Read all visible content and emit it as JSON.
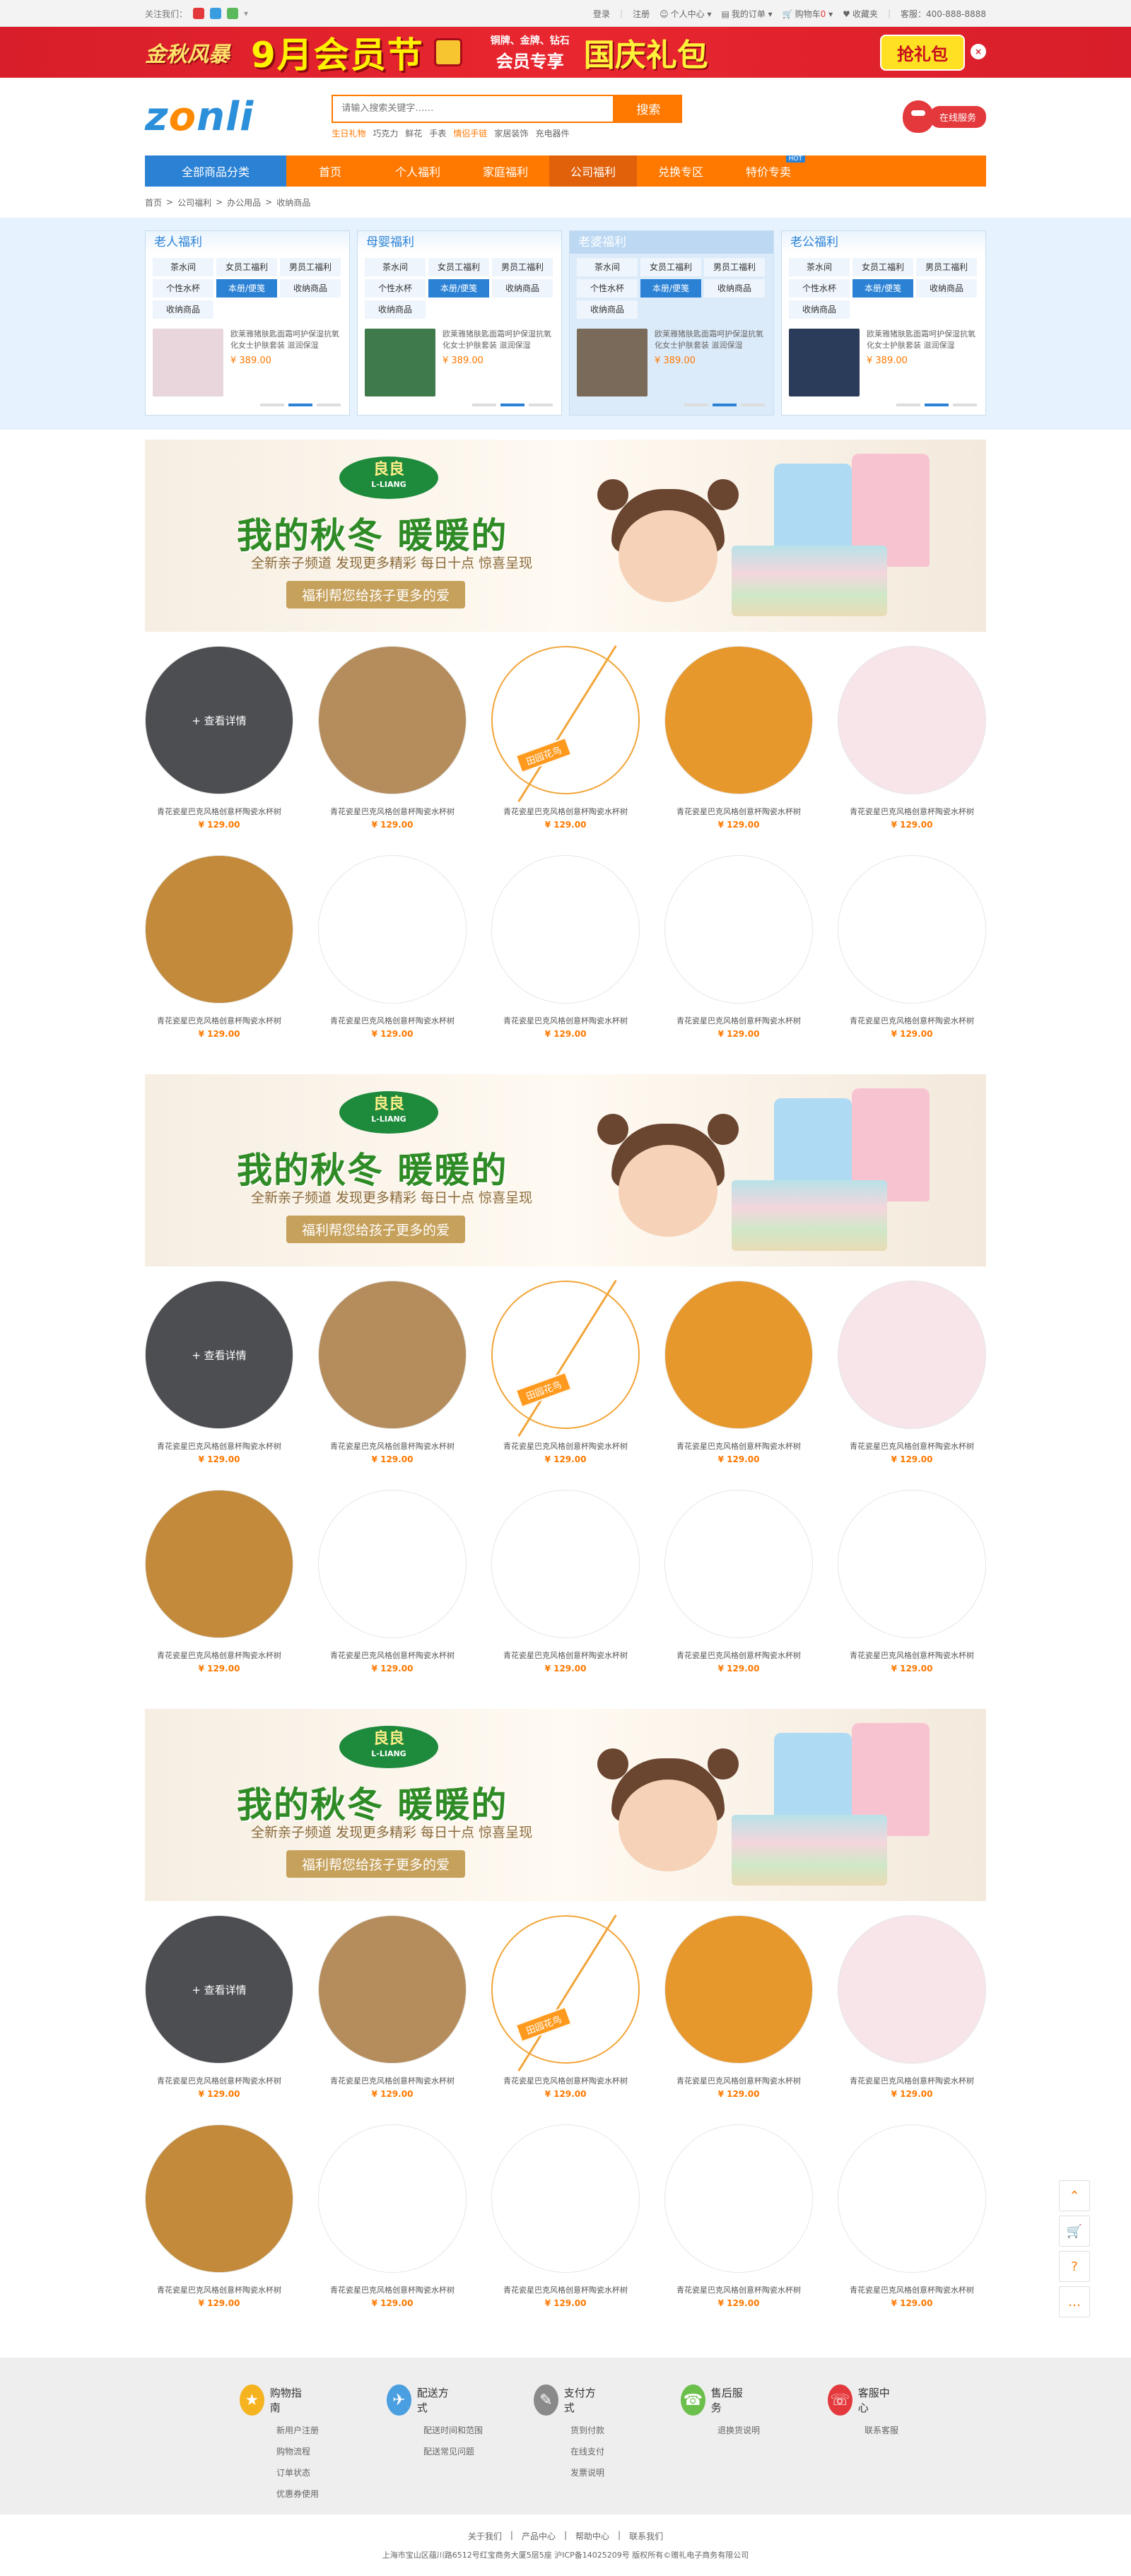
{
  "topbar": {
    "follow": "关注我们：",
    "login": "登录",
    "register": "注册",
    "personal": "个人中心",
    "orders": "我的订单",
    "cart": "购物车",
    "cart_count": "0",
    "favorites": "收藏夹",
    "hotline": "客服：400-888-8888"
  },
  "promo": {
    "brand": "金秋风暴",
    "headline": "9月会员节",
    "tier_line": "铜牌、金牌、钻石",
    "tier_bold": "会员专享",
    "gift": "国庆礼包",
    "grab": "抢礼包"
  },
  "header": {
    "logo_a": "z",
    "logo_o": "o",
    "logo_b": "nli",
    "search_placeholder": "请输入搜索关键字……",
    "search_button": "搜索",
    "hotwords": [
      "生日礼物",
      "巧克力",
      "鲜花",
      "手表",
      "情侣手链",
      "家居装饰",
      "充电器件"
    ],
    "service": "在线服务"
  },
  "nav": {
    "category": "全部商品分类",
    "items": [
      "首页",
      "个人福利",
      "家庭福利",
      "公司福利",
      "兑换专区",
      "特价专卖"
    ],
    "new_badge": "HOT"
  },
  "breadcrumb": [
    "首页",
    "公司福利",
    "办公用品",
    "收纳商品"
  ],
  "cats": [
    {
      "title": "老人福利",
      "tags": [
        "茶水间",
        "女员工福利",
        "男员工福利",
        "个性水杯",
        "本册/便笺",
        "收纳商品",
        "收纳商品"
      ],
      "desc": "欧莱雅猪肤匙面霜呵护保湿抗氧化女士护肤套装 滋润保湿",
      "price": "¥ 389.00"
    },
    {
      "title": "母婴福利",
      "tags": [
        "茶水间",
        "女员工福利",
        "男员工福利",
        "个性水杯",
        "本册/便笺",
        "收纳商品",
        "收纳商品"
      ],
      "desc": "欧莱雅猪肤匙面霜呵护保湿抗氧化女士护肤套装 滋润保湿",
      "price": "¥ 389.00"
    },
    {
      "title": "老婆福利",
      "tags": [
        "茶水间",
        "女员工福利",
        "男员工福利",
        "个性水杯",
        "本册/便笺",
        "收纳商品",
        "收纳商品"
      ],
      "desc": "欧莱雅猪肤匙面霜呵护保湿抗氧化女士护肤套装 滋润保湿",
      "price": "¥ 389.00"
    },
    {
      "title": "老公福利",
      "tags": [
        "茶水间",
        "女员工福利",
        "男员工福利",
        "个性水杯",
        "本册/便笺",
        "收纳商品",
        "收纳商品"
      ],
      "desc": "欧莱雅猪肤匙面霜呵护保湿抗氧化女士护肤套装 滋润保湿",
      "price": "¥ 389.00"
    }
  ],
  "banner": {
    "brand": "良良",
    "brand_en": "L-LIANG",
    "title": "我的秋冬 暖暖的",
    "sub": "全新亲子频道 发现更多精彩 每日十点 惊喜呈现",
    "ribbon": "福利帮您给孩子更多的爱"
  },
  "product": {
    "name": "青花瓷星巴克风格创意杯陶瓷水杯树",
    "price": "¥ 129.00",
    "overlay": "+ 查看详情",
    "tag": "田园花鸟"
  },
  "footer": {
    "cols": [
      {
        "title": "购物指南",
        "links": [
          "新用户注册",
          "购物流程",
          "订单状态",
          "优惠券使用"
        ],
        "color": "#f5b320"
      },
      {
        "title": "配送方式",
        "links": [
          "配送时间和范围",
          "配送常见问题"
        ],
        "color": "#4a9fe0"
      },
      {
        "title": "支付方式",
        "links": [
          "货到付款",
          "在线支付",
          "发票说明"
        ],
        "color": "#8a8a8a"
      },
      {
        "title": "售后服务",
        "links": [
          "退换货说明"
        ],
        "color": "#6bbf4a"
      },
      {
        "title": "客服中心",
        "links": [
          "联系客服"
        ],
        "color": "#e4393c"
      }
    ],
    "bottom_links": [
      "关于我们",
      "产品中心",
      "帮助中心",
      "联系我们"
    ],
    "address": "上海市宝山区蕴川路6512号红宝商务大厦5层5座 沪ICP备14025209号 版权所有©赠礼电子商务有限公司"
  }
}
